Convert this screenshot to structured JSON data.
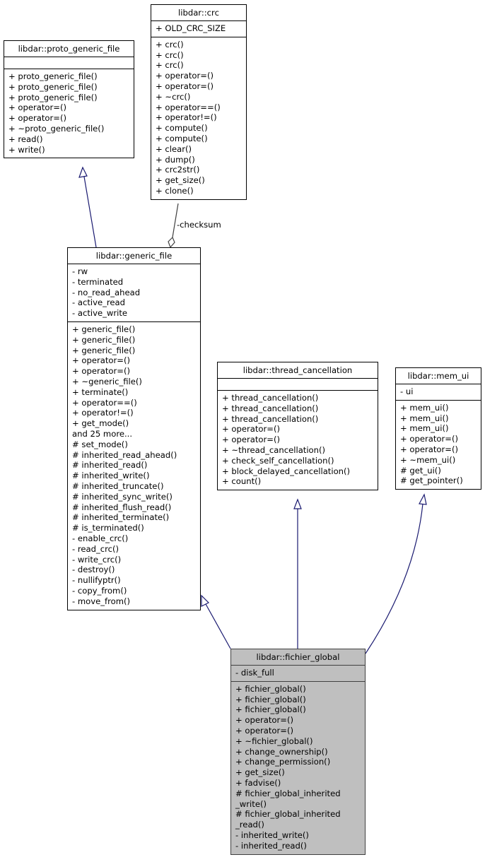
{
  "diagram": {
    "classes": {
      "proto_generic_file": {
        "name": "libdar::proto_generic_file",
        "attributes": [],
        "methods": [
          "+ proto_generic_file()",
          "+ proto_generic_file()",
          "+ proto_generic_file()",
          "+ operator=()",
          "+ operator=()",
          "+ ~proto_generic_file()",
          "+ read()",
          "+ write()"
        ]
      },
      "crc": {
        "name": "libdar::crc",
        "attributes": [
          "+ OLD_CRC_SIZE"
        ],
        "methods": [
          "+ crc()",
          "+ crc()",
          "+ crc()",
          "+ operator=()",
          "+ operator=()",
          "+ ~crc()",
          "+ operator==()",
          "+ operator!=()",
          "+ compute()",
          "+ compute()",
          "+ clear()",
          "+ dump()",
          "+ crc2str()",
          "+ get_size()",
          "+ clone()"
        ]
      },
      "generic_file": {
        "name": "libdar::generic_file",
        "attributes": [
          "- rw",
          "- terminated",
          "- no_read_ahead",
          "- active_read",
          "- active_write"
        ],
        "methods": [
          "+ generic_file()",
          "+ generic_file()",
          "+ generic_file()",
          "+ operator=()",
          "+ operator=()",
          "+ ~generic_file()",
          "+ terminate()",
          "+ operator==()",
          "+ operator!=()",
          "+ get_mode()",
          "and 25 more...",
          "# set_mode()",
          "# inherited_read_ahead()",
          "# inherited_read()",
          "# inherited_write()",
          "# inherited_truncate()",
          "# inherited_sync_write()",
          "# inherited_flush_read()",
          "# inherited_terminate()",
          "# is_terminated()",
          "- enable_crc()",
          "- read_crc()",
          "- write_crc()",
          "- destroy()",
          "- nullifyptr()",
          "- copy_from()",
          "- move_from()"
        ]
      },
      "thread_cancellation": {
        "name": "libdar::thread_cancellation",
        "attributes": [],
        "methods": [
          "+ thread_cancellation()",
          "+ thread_cancellation()",
          "+ thread_cancellation()",
          "+ operator=()",
          "+ operator=()",
          "+ ~thread_cancellation()",
          "+ check_self_cancellation()",
          "+ block_delayed_cancellation()",
          "+ count()"
        ]
      },
      "mem_ui": {
        "name": "libdar::mem_ui",
        "attributes": [
          "- ui"
        ],
        "methods": [
          "+ mem_ui()",
          "+ mem_ui()",
          "+ mem_ui()",
          "+ operator=()",
          "+ operator=()",
          "+ ~mem_ui()",
          "# get_ui()",
          "# get_pointer()"
        ]
      },
      "fichier_global": {
        "name": "libdar::fichier_global",
        "attributes": [
          "- disk_full"
        ],
        "methods": [
          "+ fichier_global()",
          "+ fichier_global()",
          "+ fichier_global()",
          "+ operator=()",
          "+ operator=()",
          "+ ~fichier_global()",
          "+ change_ownership()",
          "+ change_permission()",
          "+ get_size()",
          "+ fadvise()",
          "# fichier_global_inherited",
          "_write()",
          "# fichier_global_inherited",
          "_read()",
          "- inherited_write()",
          "- inherited_read()"
        ]
      }
    },
    "edges": {
      "checksum_label": "-checksum"
    },
    "colors": {
      "inheritance_edge": "#191970",
      "composition_edge": "#404040",
      "highlight_fill": "#bfbfbf"
    }
  }
}
